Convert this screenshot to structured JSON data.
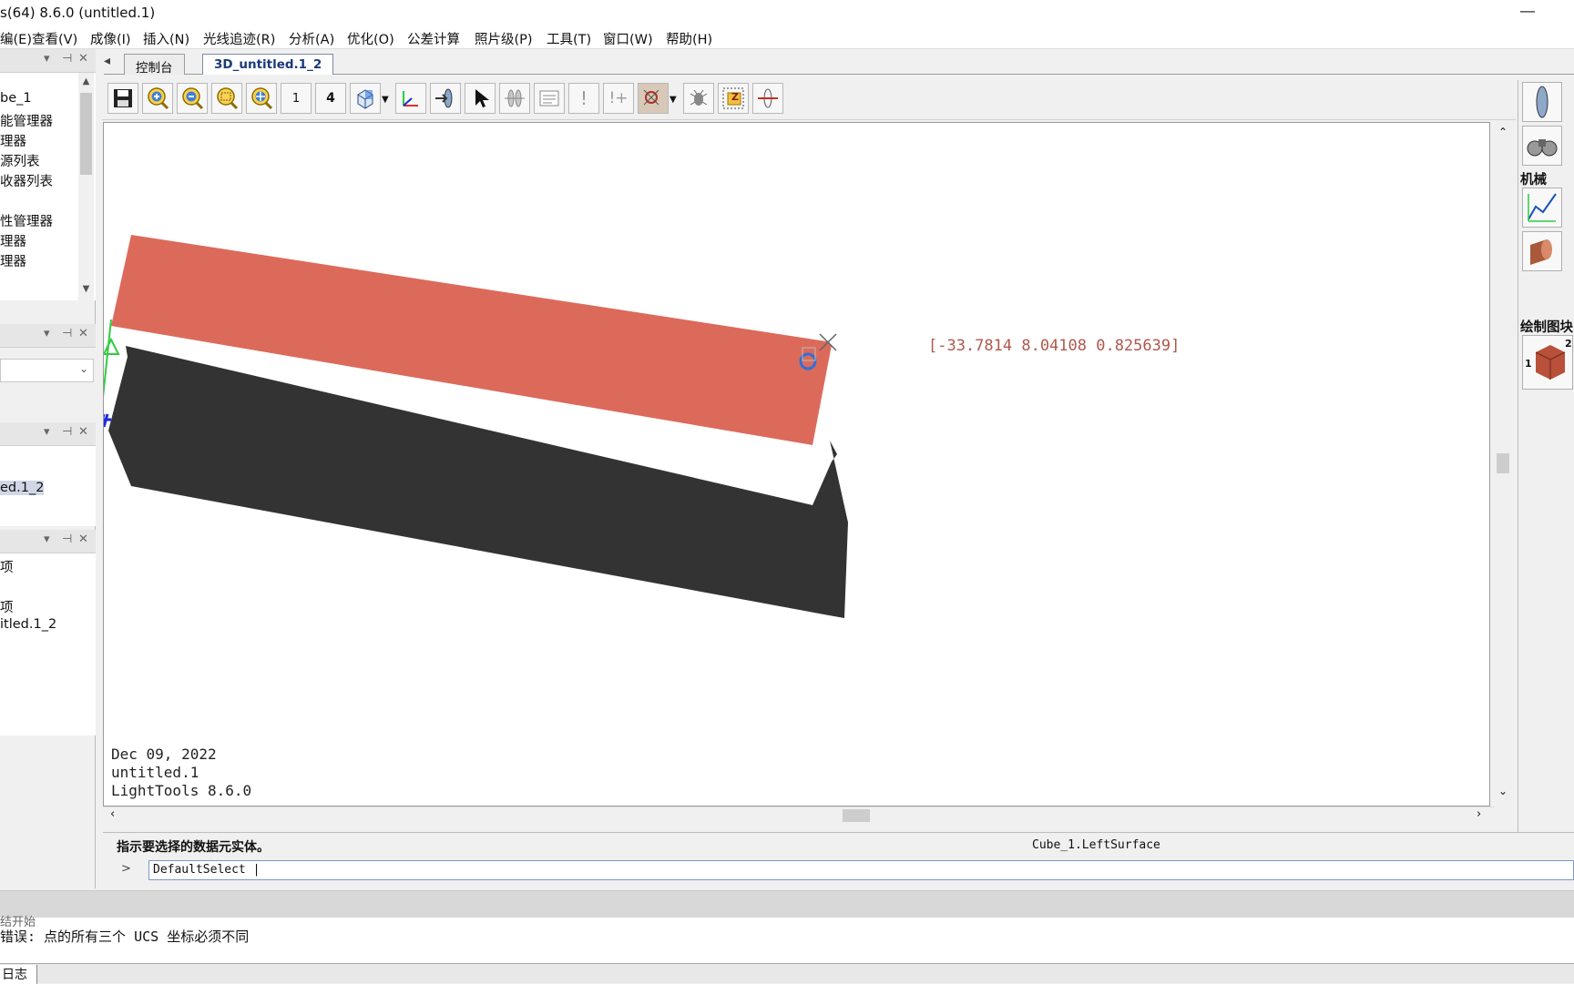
{
  "window": {
    "title": "s(64) 8.6.0  (untitled.1)",
    "minimize_glyph": "—"
  },
  "menu": [
    "编(E)",
    "查看(V)",
    "成像(I)",
    "插入(N)",
    "光线追迹(R)",
    "分析(A)",
    "优化(O)",
    "公差计算",
    "照片级(P)",
    "工具(T)",
    "窗口(W)",
    "帮助(H)"
  ],
  "left_panel": {
    "tree_items": [
      "be_1",
      "能管理器",
      "理器",
      "源列表",
      "收器列表",
      "",
      "性管理器",
      "理器",
      "理器"
    ],
    "pane3_item": "ed.1_2",
    "pane4_items": [
      "项",
      "",
      "项",
      "itled.1_2"
    ]
  },
  "tabs": {
    "back_glyph": "◂",
    "items": [
      {
        "label": "控制台",
        "active": false
      },
      {
        "label": "3D_untitled.1_2",
        "active": true
      }
    ]
  },
  "toolbar": {
    "view1_label": "1",
    "view4_label": "4",
    "z_label": "Z"
  },
  "viewport": {
    "date": "Dec 09, 2022",
    "filename": "untitled.1",
    "app_version": "LightTools 8.6.0",
    "coordinate_readout": "[-33.7814 8.04108 0.825639]",
    "colors": {
      "cube_face": "#dc6a5b",
      "cube_side": "#333333",
      "axis_y": "#2ecc40",
      "axis_z": "#1a2adc",
      "cursor_circle": "#2f6fdb"
    }
  },
  "right_panel": {
    "section_mechanical": "机械",
    "section_draw": "绘制图块",
    "cube_label_1": "1",
    "cube_label_2": "2"
  },
  "command": {
    "prompt_text": "指示要选择的数据元实体。",
    "selection_text": "Cube_1.LeftSurface",
    "input_value": "DefaultSelect |",
    "chevron": ">"
  },
  "log": {
    "line1": "结开始",
    "line2": "错误: 点的所有三个 UCS 坐标必须不同"
  },
  "bottom_tab": {
    "label": "日志"
  }
}
